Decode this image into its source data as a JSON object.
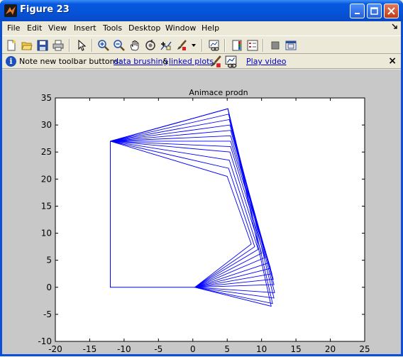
{
  "window": {
    "title": "Figure 23",
    "buttons": {
      "minimize": "_",
      "maximize": "□",
      "close": "✕"
    }
  },
  "menu": {
    "items": [
      {
        "label": "File"
      },
      {
        "label": "Edit"
      },
      {
        "label": "View"
      },
      {
        "label": "Insert"
      },
      {
        "label": "Tools"
      },
      {
        "label": "Desktop"
      },
      {
        "label": "Window"
      },
      {
        "label": "Help"
      }
    ]
  },
  "toolbar": {
    "buttons": [
      "new-figure-icon",
      "open-file-icon",
      "save-icon",
      "print-icon",
      "pointer-icon",
      "zoom-in-icon",
      "zoom-out-icon",
      "pan-icon",
      "rotate-3d-icon",
      "data-cursor-icon",
      "brush-icon",
      "dropdown-arrow-icon",
      "link-plot-icon",
      "colorbar-icon",
      "legend-icon",
      "hide-plot-tools-icon",
      "show-plot-tools-icon"
    ]
  },
  "infobar": {
    "prefix": "Note new toolbar buttons:",
    "link1": "data brushing",
    "amp": "&",
    "link2": "linked plots",
    "video": "Play video",
    "close": "×"
  },
  "plot": {
    "title": "Animace prodn",
    "xticks": [
      "-20",
      "-15",
      "-10",
      "-5",
      "0",
      "5",
      "10",
      "15",
      "20",
      "25"
    ],
    "yticks": [
      "35",
      "30",
      "25",
      "20",
      "15",
      "10",
      "5",
      "0",
      "-5",
      "-10"
    ],
    "line_color": "#0000ff"
  },
  "chart_data": {
    "type": "line",
    "title": "Animace prodn",
    "xlabel": "",
    "ylabel": "",
    "xlim": [
      -20,
      25
    ],
    "ylim": [
      -10,
      35
    ],
    "grid": false,
    "fixed_path": {
      "x": [
        -12,
        -12,
        0.3
      ],
      "y": [
        27,
        0,
        0
      ]
    },
    "linkage_frames": {
      "anchor_top": [
        -12,
        27
      ],
      "anchor_bottom": [
        0.3,
        0
      ],
      "top_joints": [
        [
          5,
          20.5
        ],
        [
          5.2,
          22
        ],
        [
          5.3,
          23.5
        ],
        [
          5.4,
          25
        ],
        [
          5.5,
          26
        ],
        [
          5.5,
          27
        ],
        [
          5.5,
          28
        ],
        [
          5.5,
          29
        ],
        [
          5.4,
          30
        ],
        [
          5.3,
          31
        ],
        [
          5.2,
          32
        ],
        [
          5.1,
          33
        ]
      ],
      "bottom_joints": [
        [
          8.5,
          8
        ],
        [
          9,
          7.5
        ],
        [
          9.5,
          7
        ],
        [
          10,
          6.3
        ],
        [
          10.5,
          5.5
        ],
        [
          11,
          4.5
        ],
        [
          11.3,
          3.5
        ],
        [
          11.5,
          2.5
        ],
        [
          11.7,
          1.5
        ],
        [
          11.8,
          0.5
        ],
        [
          11.9,
          -1
        ],
        [
          11.8,
          -2
        ],
        [
          11.6,
          -3
        ],
        [
          11.4,
          -3.5
        ]
      ]
    }
  }
}
